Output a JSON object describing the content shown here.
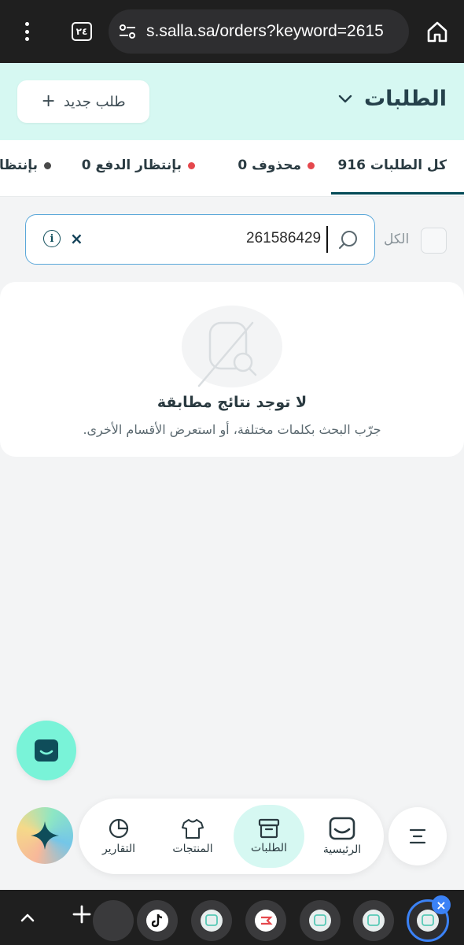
{
  "browser": {
    "tab_count": "٢٤",
    "url": "s.salla.sa/orders?keyword=2615"
  },
  "header": {
    "title": "الطلبات",
    "new_order_label": "طلب جديد"
  },
  "tabs": [
    {
      "label": "كل الطلبات 916",
      "active": true
    },
    {
      "label": "محذوف 0",
      "dot_color": "#e5484d"
    },
    {
      "label": "بإنتظار الدفع 0",
      "dot_color": "#e5484d"
    },
    {
      "label": "بإنتظار",
      "dot_color": "#4a4a4a"
    }
  ],
  "filter": {
    "select_all_label": "الكل",
    "search_value": "261586429"
  },
  "empty_state": {
    "title": "لا توجد نتائج مطابقة",
    "subtitle": "جرّب البحث بكلمات مختلفة، أو استعرض الأقسام الأخرى."
  },
  "bottom_nav": [
    {
      "label": "الرئيسية",
      "icon": "store-icon"
    },
    {
      "label": "الطلبات",
      "icon": "box-icon",
      "active": true
    },
    {
      "label": "المنتجات",
      "icon": "shirt-icon"
    },
    {
      "label": "التقارير",
      "icon": "pie-chart-icon"
    }
  ],
  "colors": {
    "brand_mint": "#d6f8f2",
    "brand_dark": "#004956",
    "chat_fab": "#79f3d8",
    "alert_dot": "#e5484d"
  }
}
